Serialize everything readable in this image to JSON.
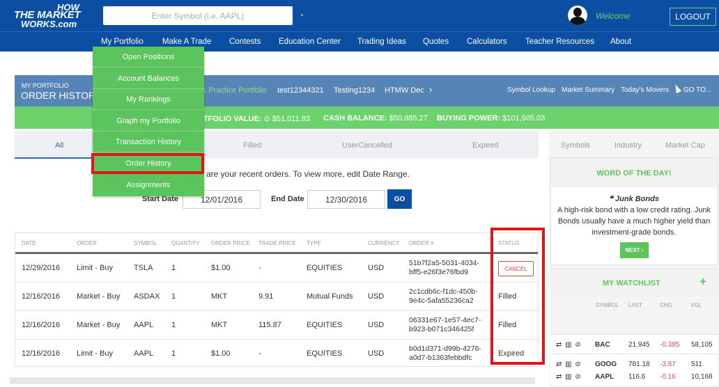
{
  "header": {
    "logo": {
      "line1": "HOW",
      "line2": "THE MARKET",
      "line3": "WORKS.com"
    },
    "search_placeholder": "Enter Symbol (i.e. AAPL)",
    "welcome": "Welcome",
    "logout": "LOGOUT"
  },
  "nav": [
    "My Portfolio",
    "Make A Trade",
    "Contests",
    "Education Center",
    "Trading Ideas",
    "Quotes",
    "Calculators",
    "Teacher Resources",
    "About"
  ],
  "dropdown": [
    "Open Positions",
    "Account Balances",
    "My Rankings",
    "Graph my Portfolio",
    "Transaction History",
    "Order History",
    "Assignments"
  ],
  "portfolio_bar": {
    "section": "MY PORTFOLIO",
    "title": "ORDER HISTORY",
    "portfolios": [
      "K Practice Portfolio",
      "test12344321",
      "Testing1234",
      "HTMW Dec"
    ],
    "next": "›",
    "links": [
      "Symbol Lookup",
      "Market Summary",
      "Today's Movers",
      "GO TO..."
    ]
  },
  "summary": {
    "portfolio_label": "RTFOLIO VALUE:",
    "portfolio_value": "$51,011.83",
    "cash_label": "CASH BALANCE:",
    "cash_value": "$50,885.27",
    "power_label": "BUYING POWER:",
    "power_value": "$101,905.03"
  },
  "filters": {
    "all": "All",
    "filled": "Filled",
    "usercancelled": "UserCancelled",
    "expired": "Expired"
  },
  "date_range": {
    "message": "are your recent orders. To view more, edit Date Range.",
    "start_label": "Start Date",
    "start_value": "12/01/2016",
    "end_label": "End Date",
    "end_value": "12/30/2016",
    "go": "GO"
  },
  "orders": {
    "columns": [
      "DATE",
      "ORDER",
      "SYMBOL",
      "QUANTITY",
      "ORDER PRICE",
      "TRADE PRICE",
      "TYPE",
      "CURRENCY",
      "ORDER #",
      "STATUS"
    ],
    "rows": [
      {
        "date": "12/29/2016",
        "order": "Limit - Buy",
        "symbol": "TSLA",
        "qty": "1",
        "oprice": "$1.00",
        "tprice": "-",
        "type": "EQUITIES",
        "currency": "USD",
        "ord1": "51b7f2a5-5031-4034-",
        "ord2": "bff5-e26f3e76fbd9",
        "status": "CANCEL"
      },
      {
        "date": "12/16/2016",
        "order": "Market - Buy",
        "symbol": "ASDAX",
        "qty": "1",
        "oprice": "MKT",
        "tprice": "9.91",
        "type": "Mutual Funds",
        "currency": "USD",
        "ord1": "2c1cdb6c-f1dc-450b-",
        "ord2": "9e4c-5afa55236ca2",
        "status": "Filled"
      },
      {
        "date": "12/16/2016",
        "order": "Market - Buy",
        "symbol": "AAPL",
        "qty": "1",
        "oprice": "MKT",
        "tprice": "115.87",
        "type": "EQUITIES",
        "currency": "USD",
        "ord1": "06331e67-1e57-4ec7-",
        "ord2": "b923-b071c346425f",
        "status": "Filled"
      },
      {
        "date": "12/16/2016",
        "order": "Limit - Buy",
        "symbol": "AAPL",
        "qty": "1",
        "oprice": "$1.00",
        "tprice": "-",
        "type": "EQUITIES",
        "currency": "USD",
        "ord1": "b0d1d371-d99b-4276-",
        "ord2": "a0d7-b1363febbdfc",
        "status": "Expired"
      }
    ]
  },
  "right_tabs": [
    "Symbols",
    "Industry",
    "Market Cap"
  ],
  "word_of_day": {
    "title": "WORD OF THE DAY!",
    "word": "❝ Junk Bonds",
    "definition": "A high-risk bond with a low credit rating. Junk Bonds usually have a much higher yield than investment-grade bonds.",
    "next": "NEXT ›"
  },
  "watchlist": {
    "title": "MY WATCHLIST",
    "add": "+",
    "icons": "⇄ ▥ ⊘",
    "columns": [
      "SYMBOL",
      "LAST",
      "CHG",
      "VOL"
    ],
    "rows": [
      {
        "symbol": "AAPL",
        "last": "116.6",
        "chg": "-0.16",
        "vol": "10,168"
      },
      {
        "symbol": "BAC",
        "last": "21.945",
        "chg": "-0.385",
        "vol": "58,105"
      },
      {
        "symbol": "GOOG",
        "last": "781.18",
        "chg": "-3.87",
        "vol": "511"
      }
    ]
  },
  "colors": {
    "brand_blue": "#0b4ea2",
    "green": "#5cc45c",
    "highlight_red": "#e01616"
  }
}
